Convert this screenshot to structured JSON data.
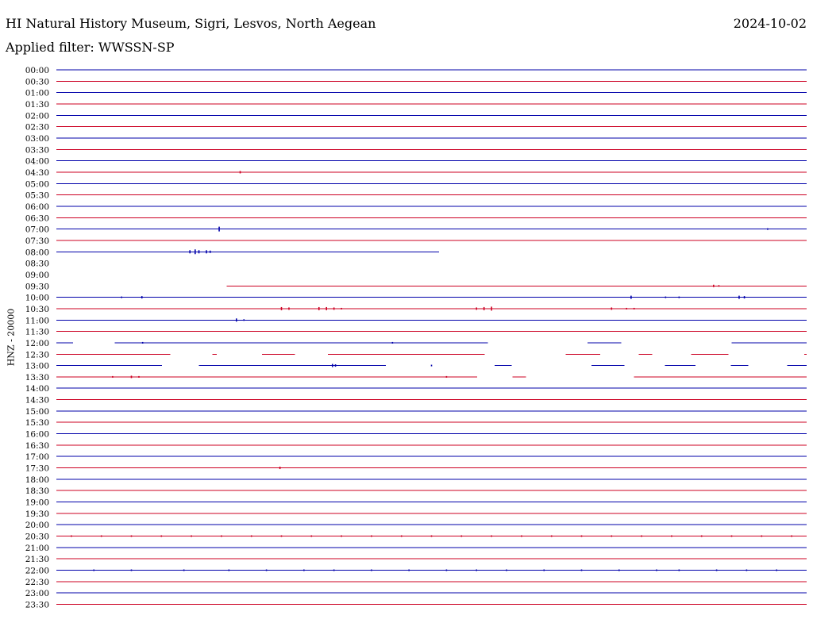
{
  "header": {
    "station": "HI Natural History Museum, Sigri, Lesvos, North Aegean",
    "date": "2024-10-02",
    "filter": "Applied filter: WWSSN-SP"
  },
  "colors": {
    "odd_trace": "#0000aa",
    "even_trace": "#cc0022"
  },
  "chart_data": {
    "type": "line",
    "title": "HI Natural History Museum, Sigri, Lesvos, North Aegean",
    "ylabel": "HNZ - 20000",
    "xlabel": "",
    "row_labels": [
      "00:00",
      "00:30",
      "01:00",
      "01:30",
      "02:00",
      "02:30",
      "03:00",
      "03:30",
      "04:00",
      "04:30",
      "05:00",
      "05:30",
      "06:00",
      "06:30",
      "07:00",
      "07:30",
      "08:00",
      "08:30",
      "09:00",
      "09:30",
      "10:00",
      "10:30",
      "11:00",
      "11:30",
      "12:00",
      "12:30",
      "13:00",
      "13:30",
      "14:00",
      "14:30",
      "15:00",
      "15:30",
      "16:00",
      "16:30",
      "17:00",
      "17:30",
      "18:00",
      "18:30",
      "19:00",
      "19:30",
      "20:00",
      "20:30",
      "21:00",
      "21:30",
      "22:00",
      "22:30",
      "23:00",
      "23:30"
    ],
    "row_minutes": 30,
    "traces": [
      {
        "row": 0,
        "segments": [
          [
            0,
            1
          ]
        ],
        "events": []
      },
      {
        "row": 1,
        "segments": [
          [
            0,
            1
          ]
        ],
        "events": []
      },
      {
        "row": 2,
        "segments": [
          [
            0,
            1
          ]
        ],
        "events": []
      },
      {
        "row": 3,
        "segments": [
          [
            0,
            1
          ]
        ],
        "events": []
      },
      {
        "row": 4,
        "segments": [
          [
            0,
            1
          ]
        ],
        "events": []
      },
      {
        "row": 5,
        "segments": [
          [
            0,
            1
          ]
        ],
        "events": []
      },
      {
        "row": 6,
        "segments": [
          [
            0,
            1
          ]
        ],
        "events": []
      },
      {
        "row": 7,
        "segments": [
          [
            0,
            1
          ]
        ],
        "events": []
      },
      {
        "row": 8,
        "segments": [
          [
            0,
            1
          ]
        ],
        "events": []
      },
      {
        "row": 9,
        "segments": [
          [
            0,
            1
          ]
        ],
        "events": [
          [
            0.245,
            1.5
          ]
        ]
      },
      {
        "row": 10,
        "segments": [
          [
            0,
            1
          ]
        ],
        "events": []
      },
      {
        "row": 11,
        "segments": [
          [
            0,
            1
          ]
        ],
        "events": []
      },
      {
        "row": 12,
        "segments": [
          [
            0,
            1
          ]
        ],
        "events": []
      },
      {
        "row": 13,
        "segments": [
          [
            0,
            1
          ]
        ],
        "events": []
      },
      {
        "row": 14,
        "segments": [
          [
            0,
            1
          ]
        ],
        "events": [
          [
            0.217,
            3
          ],
          [
            0.948,
            1
          ]
        ]
      },
      {
        "row": 15,
        "segments": [
          [
            0,
            1
          ]
        ],
        "events": []
      },
      {
        "row": 16,
        "segments": [
          [
            0,
            0.51
          ]
        ],
        "events": [
          [
            0.178,
            2
          ],
          [
            0.185,
            3
          ],
          [
            0.19,
            2
          ],
          [
            0.2,
            2
          ],
          [
            0.205,
            1.5
          ]
        ]
      },
      {
        "row": 17,
        "segments": [],
        "events": []
      },
      {
        "row": 18,
        "segments": [],
        "events": []
      },
      {
        "row": 19,
        "segments": [
          [
            0.227,
            1
          ]
        ],
        "events": [
          [
            0.876,
            1.5
          ],
          [
            0.883,
            1
          ]
        ]
      },
      {
        "row": 20,
        "segments": [
          [
            0,
            1
          ]
        ],
        "events": [
          [
            0.087,
            1
          ],
          [
            0.114,
            1.5
          ],
          [
            0.766,
            2
          ],
          [
            0.812,
            1
          ],
          [
            0.83,
            1
          ],
          [
            0.91,
            2
          ],
          [
            0.917,
            1.5
          ]
        ]
      },
      {
        "row": 21,
        "segments": [
          [
            0,
            1
          ]
        ],
        "events": [
          [
            0.3,
            2
          ],
          [
            0.31,
            1.5
          ],
          [
            0.35,
            2
          ],
          [
            0.36,
            2
          ],
          [
            0.37,
            1.5
          ],
          [
            0.38,
            1
          ],
          [
            0.56,
            1.5
          ],
          [
            0.57,
            2
          ],
          [
            0.58,
            2.5
          ],
          [
            0.74,
            1.5
          ],
          [
            0.76,
            1
          ],
          [
            0.77,
            1
          ]
        ]
      },
      {
        "row": 22,
        "segments": [
          [
            0,
            1
          ]
        ],
        "events": [
          [
            0.24,
            2
          ],
          [
            0.25,
            1
          ]
        ]
      },
      {
        "row": 23,
        "segments": [
          [
            0,
            1
          ]
        ],
        "events": []
      },
      {
        "row": 24,
        "segments": [
          [
            0,
            0.022
          ],
          [
            0.078,
            0.575
          ],
          [
            0.708,
            0.753
          ],
          [
            0.9,
            1
          ]
        ],
        "events": [
          [
            0.115,
            1
          ],
          [
            0.448,
            1
          ]
        ]
      },
      {
        "row": 25,
        "segments": [
          [
            0,
            0.152
          ],
          [
            0.208,
            0.214
          ],
          [
            0.274,
            0.318
          ],
          [
            0.362,
            0.571
          ],
          [
            0.679,
            0.725
          ],
          [
            0.776,
            0.794
          ],
          [
            0.846,
            0.896
          ],
          [
            0.997,
            1
          ]
        ],
        "events": []
      },
      {
        "row": 26,
        "segments": [
          [
            0,
            0.141
          ],
          [
            0.19,
            0.439
          ],
          [
            0.584,
            0.607
          ],
          [
            0.713,
            0.757
          ],
          [
            0.811,
            0.852
          ],
          [
            0.899,
            0.922
          ],
          [
            0.974,
            1
          ]
        ],
        "events": [
          [
            0.368,
            2
          ],
          [
            0.372,
            1.5
          ],
          [
            0.5,
            1
          ]
        ]
      },
      {
        "row": 27,
        "segments": [
          [
            0,
            0.561
          ],
          [
            0.608,
            0.626
          ],
          [
            0.77,
            1
          ]
        ],
        "events": [
          [
            0.075,
            1
          ],
          [
            0.1,
            1.5
          ],
          [
            0.11,
            1
          ],
          [
            0.52,
            1
          ]
        ]
      },
      {
        "row": 28,
        "segments": [
          [
            0,
            1
          ]
        ],
        "events": []
      },
      {
        "row": 29,
        "segments": [
          [
            0,
            1
          ]
        ],
        "events": []
      },
      {
        "row": 30,
        "segments": [
          [
            0,
            1
          ]
        ],
        "events": []
      },
      {
        "row": 31,
        "segments": [
          [
            0,
            1
          ]
        ],
        "events": []
      },
      {
        "row": 32,
        "segments": [
          [
            0,
            1
          ]
        ],
        "events": []
      },
      {
        "row": 33,
        "segments": [
          [
            0,
            1
          ]
        ],
        "events": []
      },
      {
        "row": 34,
        "segments": [
          [
            0,
            1
          ]
        ],
        "events": []
      },
      {
        "row": 35,
        "segments": [
          [
            0,
            1
          ]
        ],
        "events": [
          [
            0.298,
            1.5
          ]
        ]
      },
      {
        "row": 36,
        "segments": [
          [
            0,
            1
          ]
        ],
        "events": []
      },
      {
        "row": 37,
        "segments": [
          [
            0,
            1
          ]
        ],
        "events": []
      },
      {
        "row": 38,
        "segments": [
          [
            0,
            1
          ]
        ],
        "events": []
      },
      {
        "row": 39,
        "segments": [
          [
            0,
            1
          ]
        ],
        "events": []
      },
      {
        "row": 40,
        "segments": [
          [
            0,
            1
          ]
        ],
        "events": []
      },
      {
        "row": 41,
        "segments": [
          [
            0,
            1
          ]
        ],
        "events": [
          [
            0.02,
            1
          ],
          [
            0.06,
            1
          ],
          [
            0.1,
            1
          ],
          [
            0.14,
            1
          ],
          [
            0.18,
            1
          ],
          [
            0.22,
            1
          ],
          [
            0.26,
            1
          ],
          [
            0.3,
            1
          ],
          [
            0.34,
            1
          ],
          [
            0.38,
            1
          ],
          [
            0.42,
            1
          ],
          [
            0.46,
            1
          ],
          [
            0.5,
            1
          ],
          [
            0.54,
            1
          ],
          [
            0.58,
            1
          ],
          [
            0.62,
            1
          ],
          [
            0.66,
            1
          ],
          [
            0.7,
            1
          ],
          [
            0.74,
            1
          ],
          [
            0.78,
            1
          ],
          [
            0.82,
            1
          ],
          [
            0.86,
            1
          ],
          [
            0.9,
            1
          ],
          [
            0.94,
            1
          ],
          [
            0.98,
            1
          ]
        ]
      },
      {
        "row": 42,
        "segments": [
          [
            0,
            1
          ]
        ],
        "events": []
      },
      {
        "row": 43,
        "segments": [
          [
            0,
            1
          ]
        ],
        "events": []
      },
      {
        "row": 44,
        "segments": [
          [
            0,
            1
          ]
        ],
        "events": [
          [
            0.05,
            1
          ],
          [
            0.1,
            1
          ],
          [
            0.17,
            1
          ],
          [
            0.23,
            1
          ],
          [
            0.28,
            1
          ],
          [
            0.33,
            1
          ],
          [
            0.37,
            1
          ],
          [
            0.42,
            1
          ],
          [
            0.47,
            1
          ],
          [
            0.52,
            1
          ],
          [
            0.56,
            1
          ],
          [
            0.6,
            1
          ],
          [
            0.65,
            1
          ],
          [
            0.7,
            1
          ],
          [
            0.75,
            1
          ],
          [
            0.8,
            1
          ],
          [
            0.83,
            1
          ],
          [
            0.88,
            1
          ],
          [
            0.92,
            1
          ],
          [
            0.96,
            1
          ]
        ]
      },
      {
        "row": 45,
        "segments": [
          [
            0,
            1
          ]
        ],
        "events": []
      },
      {
        "row": 46,
        "segments": [
          [
            0,
            1
          ]
        ],
        "events": []
      },
      {
        "row": 47,
        "segments": [
          [
            0,
            1
          ]
        ],
        "events": []
      }
    ]
  }
}
